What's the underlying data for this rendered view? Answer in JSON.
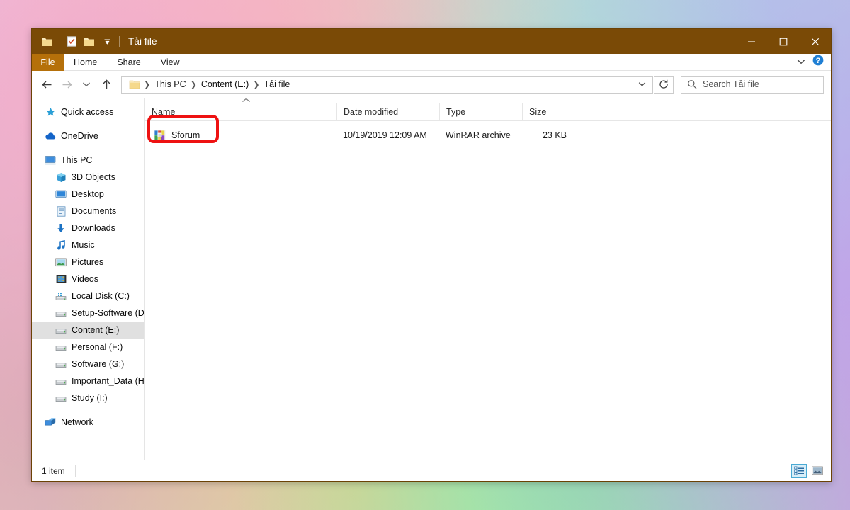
{
  "window": {
    "title": "Tải file",
    "quick_access": [
      {
        "name": "folder-icon",
        "label": "Folder"
      },
      {
        "name": "properties-icon",
        "label": "Properties"
      },
      {
        "name": "new-folder-icon",
        "label": "New folder"
      },
      {
        "name": "chevron-down-icon",
        "label": "Customize Quick Access Toolbar"
      }
    ],
    "controls": {
      "minimize": "Minimize",
      "maximize": "Maximize",
      "close": "Close"
    },
    "titlebar_color": "#7a4a06",
    "file_tab_color": "#b5700a"
  },
  "ribbon": {
    "file_tab": "File",
    "tabs": [
      "Home",
      "Share",
      "View"
    ],
    "expand_icon": "chevron-down-icon",
    "help_icon": "help-icon"
  },
  "navbar": {
    "back": "Back",
    "forward": "Forward",
    "recent_locations": "Recent locations",
    "up": "Up",
    "breadcrumb": [
      "This PC",
      "Content (E:)",
      "Tải file"
    ],
    "address_chevron": "chevron-down-icon",
    "refresh": "refresh-icon",
    "search": {
      "placeholder": "Search Tải file",
      "value": "",
      "icon": "search-icon"
    }
  },
  "sidebar": {
    "items": [
      {
        "label": "Quick access",
        "icon": "star-icon",
        "indent": false,
        "selected": false,
        "gap_after": true
      },
      {
        "label": "OneDrive",
        "icon": "cloud-icon",
        "indent": false,
        "selected": false,
        "gap_after": true
      },
      {
        "label": "This PC",
        "icon": "computer-icon",
        "indent": false,
        "selected": false,
        "gap_after": false
      },
      {
        "label": "3D Objects",
        "icon": "3d-objects-icon",
        "indent": true,
        "selected": false,
        "gap_after": false
      },
      {
        "label": "Desktop",
        "icon": "desktop-icon",
        "indent": true,
        "selected": false,
        "gap_after": false
      },
      {
        "label": "Documents",
        "icon": "documents-icon",
        "indent": true,
        "selected": false,
        "gap_after": false
      },
      {
        "label": "Downloads",
        "icon": "downloads-icon",
        "indent": true,
        "selected": false,
        "gap_after": false
      },
      {
        "label": "Music",
        "icon": "music-icon",
        "indent": true,
        "selected": false,
        "gap_after": false
      },
      {
        "label": "Pictures",
        "icon": "pictures-icon",
        "indent": true,
        "selected": false,
        "gap_after": false
      },
      {
        "label": "Videos",
        "icon": "videos-icon",
        "indent": true,
        "selected": false,
        "gap_after": false
      },
      {
        "label": "Local Disk (C:)",
        "icon": "system-drive-icon",
        "indent": true,
        "selected": false,
        "gap_after": false
      },
      {
        "label": "Setup-Software (D:)",
        "icon": "drive-icon",
        "indent": true,
        "selected": false,
        "gap_after": false
      },
      {
        "label": "Content (E:)",
        "icon": "drive-icon",
        "indent": true,
        "selected": true,
        "gap_after": false
      },
      {
        "label": "Personal (F:)",
        "icon": "drive-icon",
        "indent": true,
        "selected": false,
        "gap_after": false
      },
      {
        "label": "Software (G:)",
        "icon": "drive-icon",
        "indent": true,
        "selected": false,
        "gap_after": false
      },
      {
        "label": "Important_Data (H:)",
        "icon": "drive-icon",
        "indent": true,
        "selected": false,
        "gap_after": false
      },
      {
        "label": "Study (I:)",
        "icon": "drive-icon",
        "indent": true,
        "selected": false,
        "gap_after": true
      },
      {
        "label": "Network",
        "icon": "network-icon",
        "indent": false,
        "selected": false,
        "gap_after": false
      }
    ]
  },
  "filelist": {
    "columns": [
      {
        "label": "Name",
        "sorted": "asc"
      },
      {
        "label": "Date modified",
        "sorted": ""
      },
      {
        "label": "Type",
        "sorted": ""
      },
      {
        "label": "Size",
        "sorted": ""
      }
    ],
    "rows": [
      {
        "name": "Sforum",
        "date_modified": "10/19/2019 12:09 AM",
        "type": "WinRAR archive",
        "size": "23 KB",
        "icon": "winrar-archive-icon",
        "highlighted": true
      }
    ],
    "annotation_color": "#ee1111"
  },
  "statusbar": {
    "item_count": "1 item",
    "views": [
      {
        "name": "details-view-button",
        "label": "Details",
        "active": true
      },
      {
        "name": "large-icons-view-button",
        "label": "Large icons",
        "active": false
      }
    ]
  }
}
